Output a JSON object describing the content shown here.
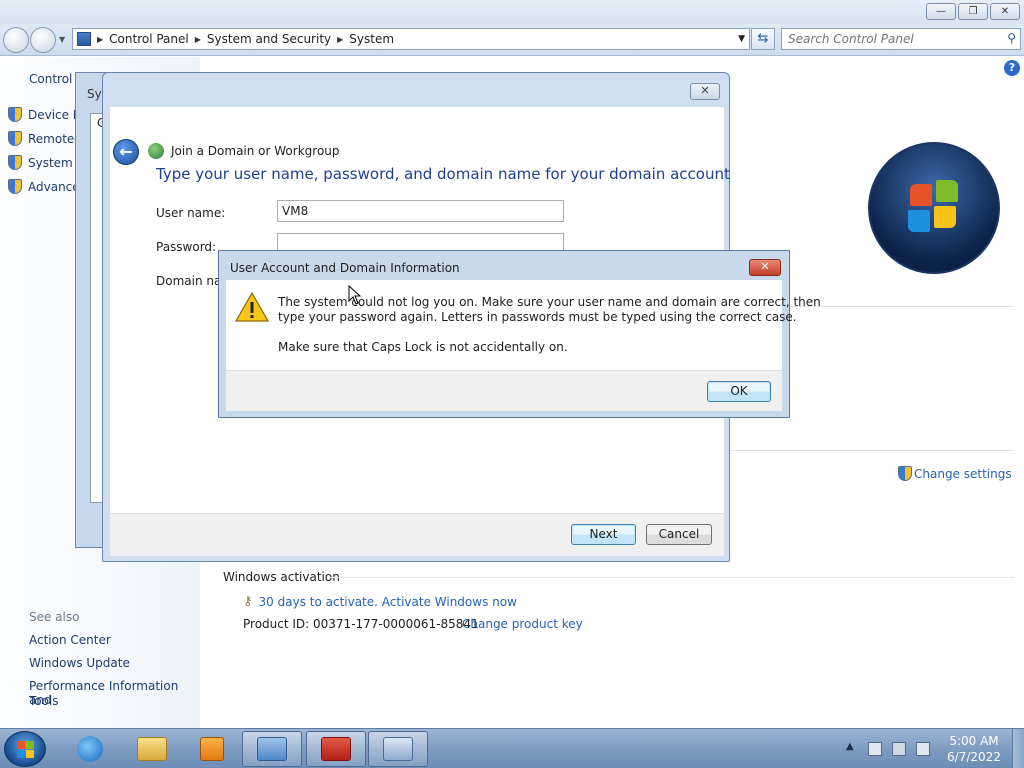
{
  "explorer": {
    "address": {
      "crumbs": [
        "Control Panel",
        "System and Security",
        "System"
      ]
    },
    "search": {
      "placeholder": "Search Control Panel"
    },
    "left_tasks": {
      "home": "Control P",
      "items": [
        "Device M",
        "Remote s",
        "System p",
        "Advance"
      ]
    },
    "see_also": {
      "heading": "See also",
      "items": [
        "Action Center",
        "Windows Update",
        "Performance Information and",
        "Tools"
      ]
    },
    "change_settings": "Change settings",
    "activation": {
      "heading": "Windows activation",
      "activate_link": "30 days to activate. Activate Windows now",
      "product_id_label": "Product ID: 00371-177-0000061-85841",
      "change_key_link": "Change product key"
    }
  },
  "sysprops": {
    "title_fragment": "Sys",
    "tab_fragment": "C"
  },
  "join_dialog": {
    "title": "Join a Domain or Workgroup",
    "heading": "Type your user name, password, and domain name for your domain account",
    "username_label": "User name:",
    "username_value": "VM8",
    "password_label": "Password:",
    "domain_label": "Domain nam",
    "next_label": "Next",
    "cancel_label": "Cancel"
  },
  "error_dialog": {
    "title": "User Account and Domain Information",
    "line1": "The system could not log you on.  Make sure your user name and domain are correct, then",
    "line2": "type your password again.  Letters in passwords must be typed using the correct case.",
    "line3": "Make sure that Caps Lock is not accidentally on.",
    "ok_label": "OK"
  },
  "taskbar": {
    "time": "5:00 AM",
    "date": "6/7/2022"
  },
  "colors": {
    "accent": "#1f3f8f",
    "link": "#1e4fa6",
    "taskbar": "#7f9cc2"
  }
}
